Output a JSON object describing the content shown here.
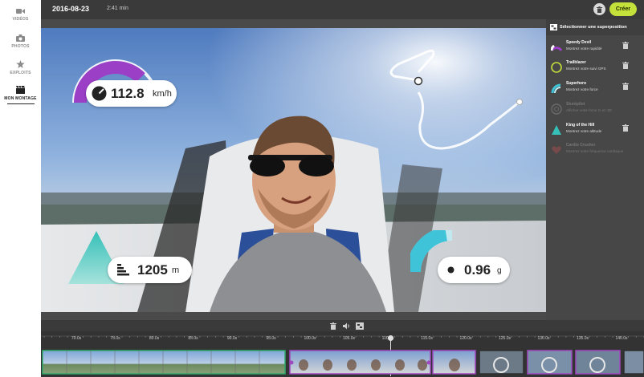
{
  "header": {
    "date": "2016-08-23",
    "duration": "2:41 min",
    "create_label": "Créer"
  },
  "sidebar": {
    "items": [
      {
        "label": "VIDÉOS",
        "icon": "video-camera-icon",
        "active": false
      },
      {
        "label": "PHOTOS",
        "icon": "photo-camera-icon",
        "active": false
      },
      {
        "label": "EXPLOITS",
        "icon": "star-icon",
        "active": false
      },
      {
        "label": "MON MONTAGE",
        "icon": "clapperboard-icon",
        "active": true
      }
    ]
  },
  "hud": {
    "speed_value": "112.8",
    "speed_unit": "km/h",
    "altitude_value": "1205",
    "altitude_unit": "m",
    "gforce_value": "0.96",
    "gforce_unit": "g",
    "speed_fraction": 0.75,
    "gforce_fraction": 0.45
  },
  "panel": {
    "title": "Sélectionner une superposition",
    "items": [
      {
        "name": "Speedy Devil",
        "desc": "Montrez votre rapidité",
        "enabled": true
      },
      {
        "name": "Trailblazer",
        "desc": "Montrez votre suivi GPS",
        "enabled": true
      },
      {
        "name": "Superhero",
        "desc": "Montrez votre force",
        "enabled": true
      },
      {
        "name": "Stuntpilot",
        "desc": "Afficher votre force G en 3D",
        "enabled": false
      },
      {
        "name": "King of the Hill",
        "desc": "Montrez votre altitude",
        "enabled": true
      },
      {
        "name": "Cardio Crusher",
        "desc": "Montrez votre fréquence cardiaque",
        "enabled": false
      }
    ]
  },
  "timeline": {
    "ticks": [
      "70.0s",
      "75.0s",
      "80.0s",
      "85.0s",
      "90.0s",
      "95.0s",
      "100.0s",
      "105.0s",
      "110.0s",
      "115.0s",
      "120.0s",
      "125.0s",
      "130.0s",
      "135.0s",
      "140.0s"
    ]
  },
  "colors": {
    "accent_green": "#c4e03a",
    "speed_purple": "#9b3fc7",
    "altitude_teal": "#35c0b8",
    "gforce_cyan": "#3fc3d8"
  }
}
